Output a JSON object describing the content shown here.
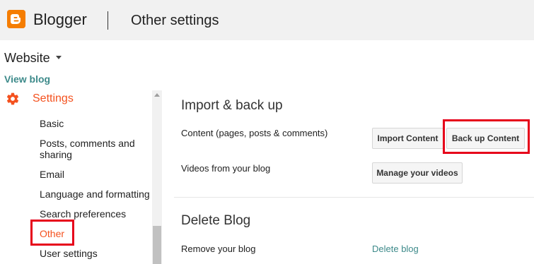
{
  "header": {
    "brand": "Blogger",
    "page_title": "Other settings",
    "logo_icon": "blogger-logo-icon",
    "logo_color": "#f57d00"
  },
  "sidebar": {
    "blog_name": "Website",
    "view_blog": "View blog",
    "section_label": "Settings",
    "section_icon": "gear-icon",
    "accent_color": "#f4511e",
    "items": [
      {
        "label": "Basic",
        "active": false
      },
      {
        "label": "Posts, comments and",
        "label2": "sharing",
        "active": false
      },
      {
        "label": "Email",
        "active": false
      },
      {
        "label": "Language and formatting",
        "active": false
      },
      {
        "label": "Search preferences",
        "active": false
      },
      {
        "label": "Other",
        "active": true
      },
      {
        "label": "User settings",
        "active": false
      }
    ]
  },
  "main": {
    "import_section": {
      "title": "Import & back up",
      "content_label": "Content (pages, posts & comments)",
      "import_button": "Import Content",
      "backup_button": "Back up Content",
      "videos_label": "Videos from your blog",
      "manage_videos_button": "Manage your videos"
    },
    "delete_section": {
      "title": "Delete Blog",
      "remove_label": "Remove your blog",
      "delete_link": "Delete blog"
    }
  },
  "annotations": {
    "highlight_color": "#e6001a"
  }
}
